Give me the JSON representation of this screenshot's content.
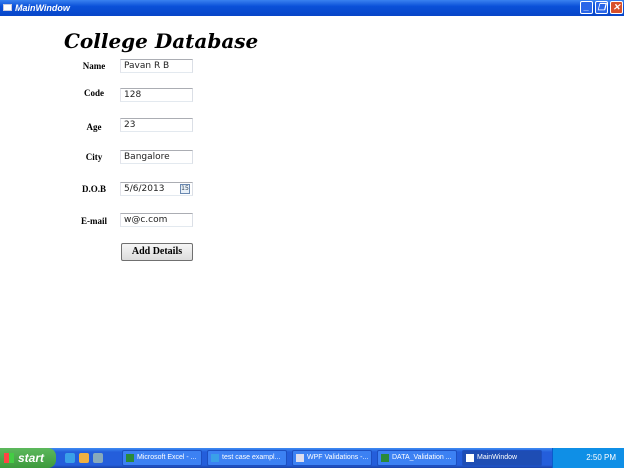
{
  "window": {
    "title": "MainWindow"
  },
  "form": {
    "heading": "College Database",
    "fields": [
      {
        "label": "Name",
        "value": "Pavan R B"
      },
      {
        "label": "Code",
        "value": "128"
      },
      {
        "label": "Age",
        "value": "23"
      },
      {
        "label": "City",
        "value": "Bangalore"
      },
      {
        "label": "D.O.B",
        "value": "5/6/2013"
      },
      {
        "label": "E-mail",
        "value": "w@c.com"
      }
    ],
    "calendar_glyph": "15",
    "submit_label": "Add Details"
  },
  "taskbar": {
    "start_label": "start",
    "tasks": [
      "Microsoft Excel - ...",
      "test case exampl...",
      "WPF Validations -...",
      "DATA_Validation ...",
      "MainWindow"
    ],
    "clock": "2:50 PM"
  }
}
